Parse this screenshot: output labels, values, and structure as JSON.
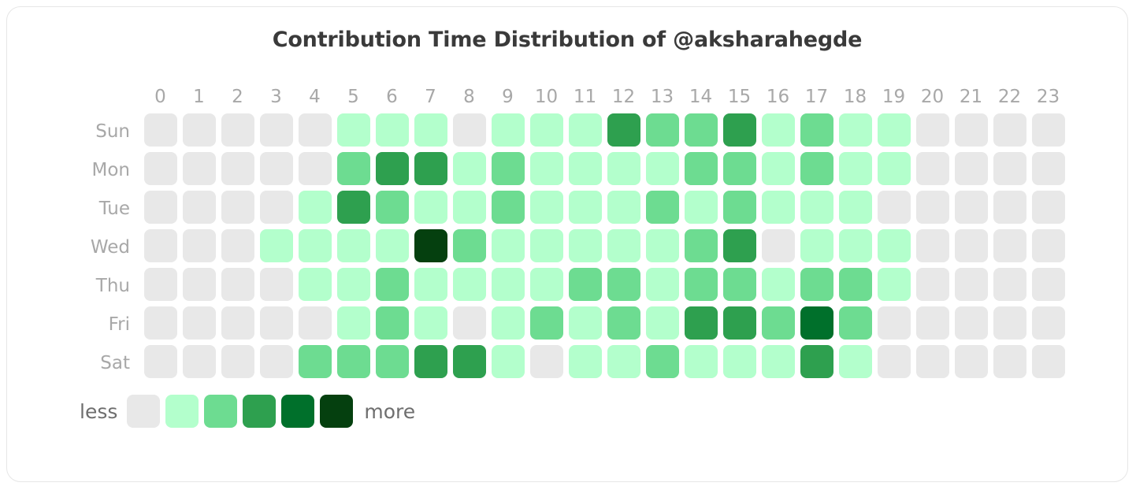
{
  "card": {
    "title": "Contribution Time Distribution of @aksharahegde"
  },
  "legend": {
    "less_label": "less",
    "more_label": "more",
    "colors": [
      "#e8e8e8",
      "#b3ffcc",
      "#6ddc91",
      "#2ea04f",
      "#00702b",
      "#05400f"
    ]
  },
  "chart_data": {
    "type": "heatmap",
    "title": "Contribution Time Distribution of @aksharahegde",
    "xlabel": "",
    "ylabel": "",
    "legend_position": "bottom-left",
    "grid": false,
    "color_scale": [
      "#e8e8e8",
      "#b3ffcc",
      "#6ddc91",
      "#2ea04f",
      "#00702b",
      "#05400f"
    ],
    "level_range": [
      0,
      5
    ],
    "x": [
      "0",
      "1",
      "2",
      "3",
      "4",
      "5",
      "6",
      "7",
      "8",
      "9",
      "10",
      "11",
      "12",
      "13",
      "14",
      "15",
      "16",
      "17",
      "18",
      "19",
      "20",
      "21",
      "22",
      "23"
    ],
    "y": [
      "Sun",
      "Mon",
      "Tue",
      "Wed",
      "Thu",
      "Fri",
      "Sat"
    ],
    "values": [
      [
        0,
        0,
        0,
        0,
        0,
        1,
        1,
        1,
        0,
        1,
        1,
        1,
        3,
        2,
        2,
        3,
        1,
        2,
        1,
        1,
        0,
        0,
        0,
        0
      ],
      [
        0,
        0,
        0,
        0,
        0,
        2,
        3,
        3,
        1,
        2,
        1,
        1,
        1,
        1,
        2,
        2,
        1,
        2,
        1,
        1,
        0,
        0,
        0,
        0
      ],
      [
        0,
        0,
        0,
        0,
        1,
        3,
        2,
        1,
        1,
        2,
        1,
        1,
        1,
        2,
        1,
        2,
        1,
        1,
        1,
        0,
        0,
        0,
        0,
        0
      ],
      [
        0,
        0,
        0,
        1,
        1,
        1,
        1,
        5,
        2,
        1,
        1,
        1,
        1,
        1,
        2,
        3,
        0,
        1,
        1,
        1,
        0,
        0,
        0,
        0
      ],
      [
        0,
        0,
        0,
        0,
        1,
        1,
        2,
        1,
        1,
        1,
        1,
        2,
        2,
        1,
        2,
        2,
        1,
        2,
        2,
        1,
        0,
        0,
        0,
        0
      ],
      [
        0,
        0,
        0,
        0,
        0,
        1,
        2,
        1,
        0,
        1,
        2,
        1,
        2,
        1,
        3,
        3,
        2,
        4,
        2,
        0,
        0,
        0,
        0,
        0
      ],
      [
        0,
        0,
        0,
        0,
        2,
        2,
        2,
        3,
        3,
        1,
        0,
        1,
        1,
        2,
        1,
        1,
        1,
        3,
        1,
        0,
        0,
        0,
        0,
        0
      ]
    ]
  }
}
